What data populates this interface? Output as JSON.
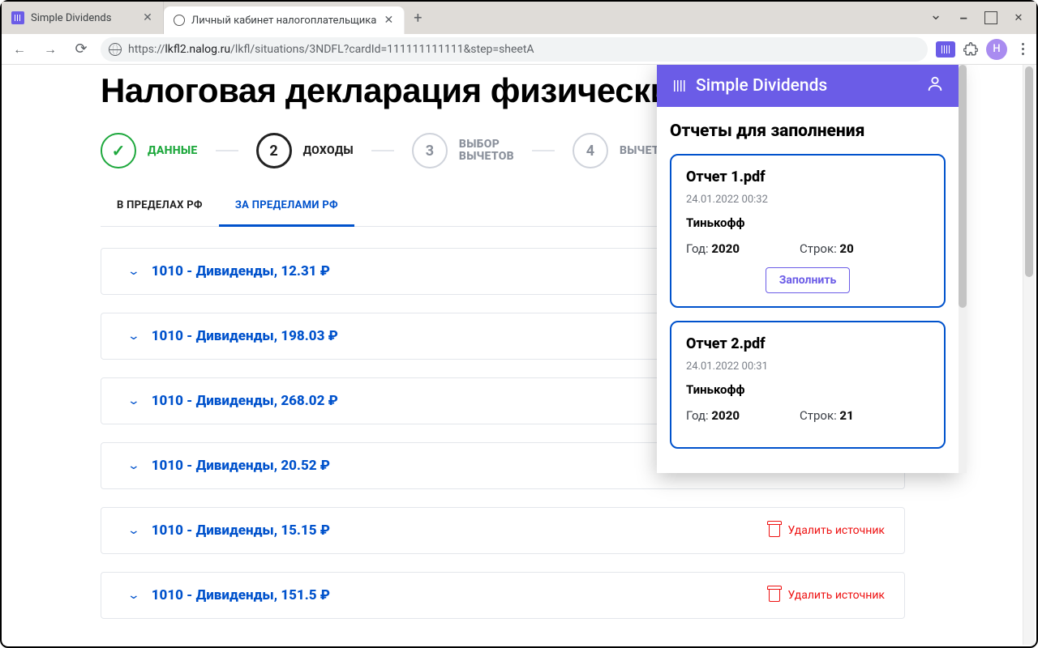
{
  "browser": {
    "tabs": [
      {
        "title": "Simple Dividends",
        "active": false
      },
      {
        "title": "Личный кабинет налогоплательщика",
        "active": true
      }
    ],
    "url_prefix": "https://",
    "url_host": "lkfl2.nalog.ru",
    "url_path": "/lkfl/situations/3NDFL?cardId=111111111111&step=sheetA",
    "avatar_letter": "Н"
  },
  "page": {
    "title": "Налоговая декларация физических лиц",
    "steps": [
      {
        "num": "✓",
        "label": "ДАННЫЕ",
        "state": "done"
      },
      {
        "num": "2",
        "label": "ДОХОДЫ",
        "state": "active"
      },
      {
        "num": "3",
        "label": "ВЫБОР\nВЫЧЕТОВ",
        "state": ""
      },
      {
        "num": "4",
        "label": "ВЫЧЕТЫ",
        "state": ""
      }
    ],
    "tabs": [
      {
        "label": "В ПРЕДЕЛАХ РФ",
        "active": false
      },
      {
        "label": "ЗА ПРЕДЕЛАМИ РФ",
        "active": true
      }
    ],
    "delete_label": "Удалить источник",
    "rows": [
      {
        "text": "1010 - Дивиденды, 12.31 ₽",
        "deletable": false
      },
      {
        "text": "1010 - Дивиденды, 198.03 ₽",
        "deletable": false
      },
      {
        "text": "1010 - Дивиденды, 268.02 ₽",
        "deletable": false
      },
      {
        "text": "1010 - Дивиденды, 20.52 ₽",
        "deletable": false
      },
      {
        "text": "1010 - Дивиденды, 15.15 ₽",
        "deletable": true
      },
      {
        "text": "1010 - Дивиденды, 151.5 ₽",
        "deletable": true
      }
    ]
  },
  "panel": {
    "brand": "Simple Dividends",
    "heading": "Отчеты для заполнения",
    "year_label": "Год:",
    "rows_label": "Строк:",
    "fill_label": "Заполнить",
    "reports": [
      {
        "name": "Отчет 1.pdf",
        "date": "24.01.2022 00:32",
        "broker": "Тинькофф",
        "year": "2020",
        "rows": "20",
        "show_button": true
      },
      {
        "name": "Отчет 2.pdf",
        "date": "24.01.2022 00:31",
        "broker": "Тинькофф",
        "year": "2020",
        "rows": "21",
        "show_button": false
      }
    ]
  }
}
